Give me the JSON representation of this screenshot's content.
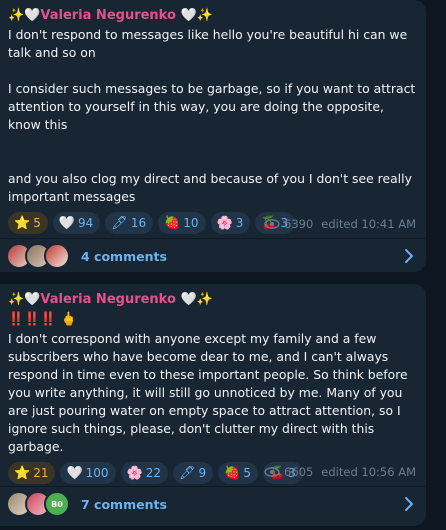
{
  "posts": [
    {
      "author": "Valeria Negurenko",
      "text": "I don't respond to messages like hello you're beautiful hi can we talk and so on\n\nI consider such messages to be garbage, so if you want to attract attention to yourself in this way, you are doing the opposite, know this\n\n\nand you also clog my direct and because of you I don't see really important messages",
      "reactions": [
        {
          "emoji": "⭐",
          "count": "5",
          "icon": "star-icon"
        },
        {
          "emoji": "🤍",
          "count": "94",
          "icon": "heart-icon"
        },
        {
          "emoji": "🖊",
          "count": "16",
          "icon": "pen-icon"
        },
        {
          "emoji": "🍓",
          "count": "10",
          "icon": "strawberry-icon"
        },
        {
          "emoji": "🌸",
          "count": "3",
          "icon": "flower-icon"
        },
        {
          "emoji": "🍒",
          "count": "3",
          "icon": "cherries-icon"
        }
      ],
      "views": "6390",
      "edited": "edited 10:41 AM",
      "comments": "4 comments"
    },
    {
      "author": "Valeria Negurenko",
      "emoji_line": "‼️‼️‼️ 🖕",
      "text": "I don't correspond with anyone except my family and a few subscribers who have become dear to me, and I can't always respond in time even to these important people. So think before you write anything, it will still go unnoticed by me. Many of you are just pouring water on empty space to attract attention, so I ignore such things, please, don't clutter my direct with this garbage.",
      "reactions": [
        {
          "emoji": "⭐",
          "count": "21",
          "icon": "star-icon"
        },
        {
          "emoji": "🤍",
          "count": "100",
          "icon": "heart-icon"
        },
        {
          "emoji": "🌸",
          "count": "22",
          "icon": "flower-icon"
        },
        {
          "emoji": "🖊",
          "count": "9",
          "icon": "pen-icon"
        },
        {
          "emoji": "🍓",
          "count": "5",
          "icon": "strawberry-icon"
        },
        {
          "emoji": "🍒",
          "count": "3",
          "icon": "cherries-icon"
        }
      ],
      "views": "6605",
      "edited": "edited 10:56 AM",
      "comments": "7 comments",
      "avatar_initials": "B0"
    }
  ],
  "colors": {
    "background": "#0e1621",
    "card": "#182533",
    "accent": "#6ab3f3",
    "author": "#e8508c"
  }
}
